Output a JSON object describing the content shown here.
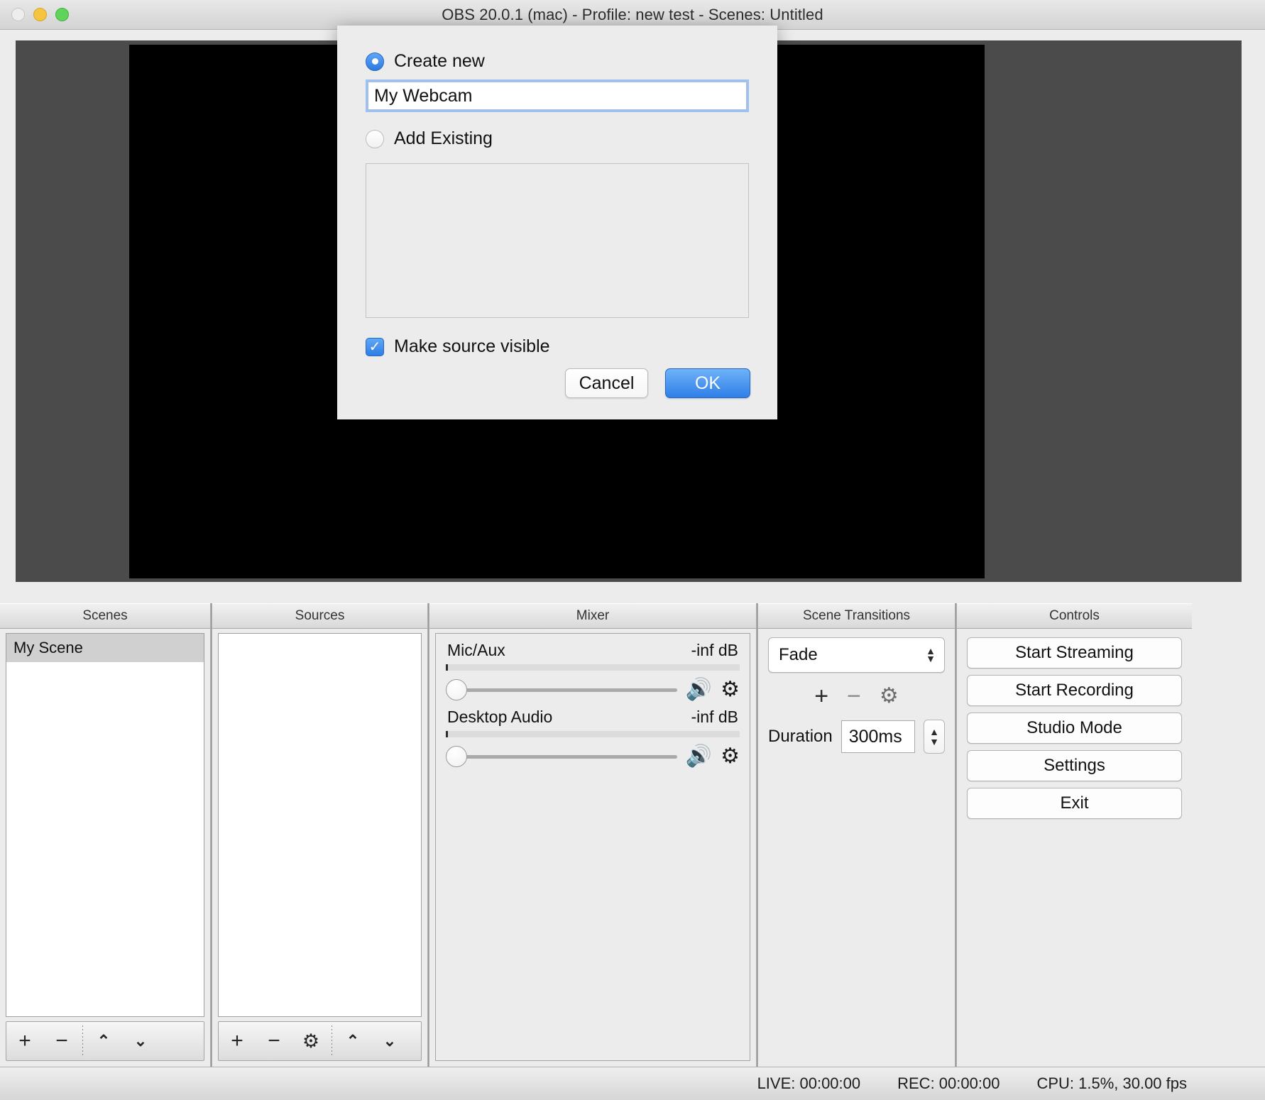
{
  "window": {
    "title": "OBS 20.0.1 (mac) - Profile: new test - Scenes: Untitled",
    "traffic_lights": [
      "close",
      "minimize",
      "maximize"
    ]
  },
  "dialog": {
    "create_new": {
      "label": "Create new",
      "selected": true
    },
    "name_input": {
      "value": "My Webcam",
      "placeholder": ""
    },
    "add_existing": {
      "label": "Add Existing",
      "selected": false
    },
    "existing_list": [],
    "make_visible": {
      "label": "Make source visible",
      "checked": true
    },
    "cancel_label": "Cancel",
    "ok_label": "OK",
    "accent_color": "#2f7fe8"
  },
  "docks": {
    "scenes": {
      "title": "Scenes",
      "items": [
        {
          "label": "My Scene",
          "selected": true
        }
      ],
      "toolbar": {
        "add": "+",
        "remove": "−",
        "up": "⌃",
        "down": "⌄"
      }
    },
    "sources": {
      "title": "Sources",
      "items": [],
      "toolbar": {
        "add": "+",
        "remove": "−",
        "properties": "⚙",
        "up": "⌃",
        "down": "⌄"
      }
    },
    "mixer": {
      "title": "Mixer",
      "channels": [
        {
          "name": "Mic/Aux",
          "level": "-inf dB",
          "volume_icon": "🔊",
          "gear_icon": "⚙"
        },
        {
          "name": "Desktop Audio",
          "level": "-inf dB",
          "volume_icon": "🔊",
          "gear_icon": "⚙"
        }
      ]
    },
    "scene_transitions": {
      "title": "Scene Transitions",
      "selected_transition": "Fade",
      "transition_options": [
        "Fade"
      ],
      "add": "+",
      "remove": "−",
      "properties": "⚙",
      "duration_label": "Duration",
      "duration_value": "300ms"
    },
    "controls": {
      "title": "Controls",
      "buttons": [
        "Start Streaming",
        "Start Recording",
        "Studio Mode",
        "Settings",
        "Exit"
      ]
    }
  },
  "statusbar": {
    "live": "LIVE: 00:00:00",
    "rec": "REC: 00:00:00",
    "cpu": "CPU: 1.5%, 30.00 fps"
  }
}
